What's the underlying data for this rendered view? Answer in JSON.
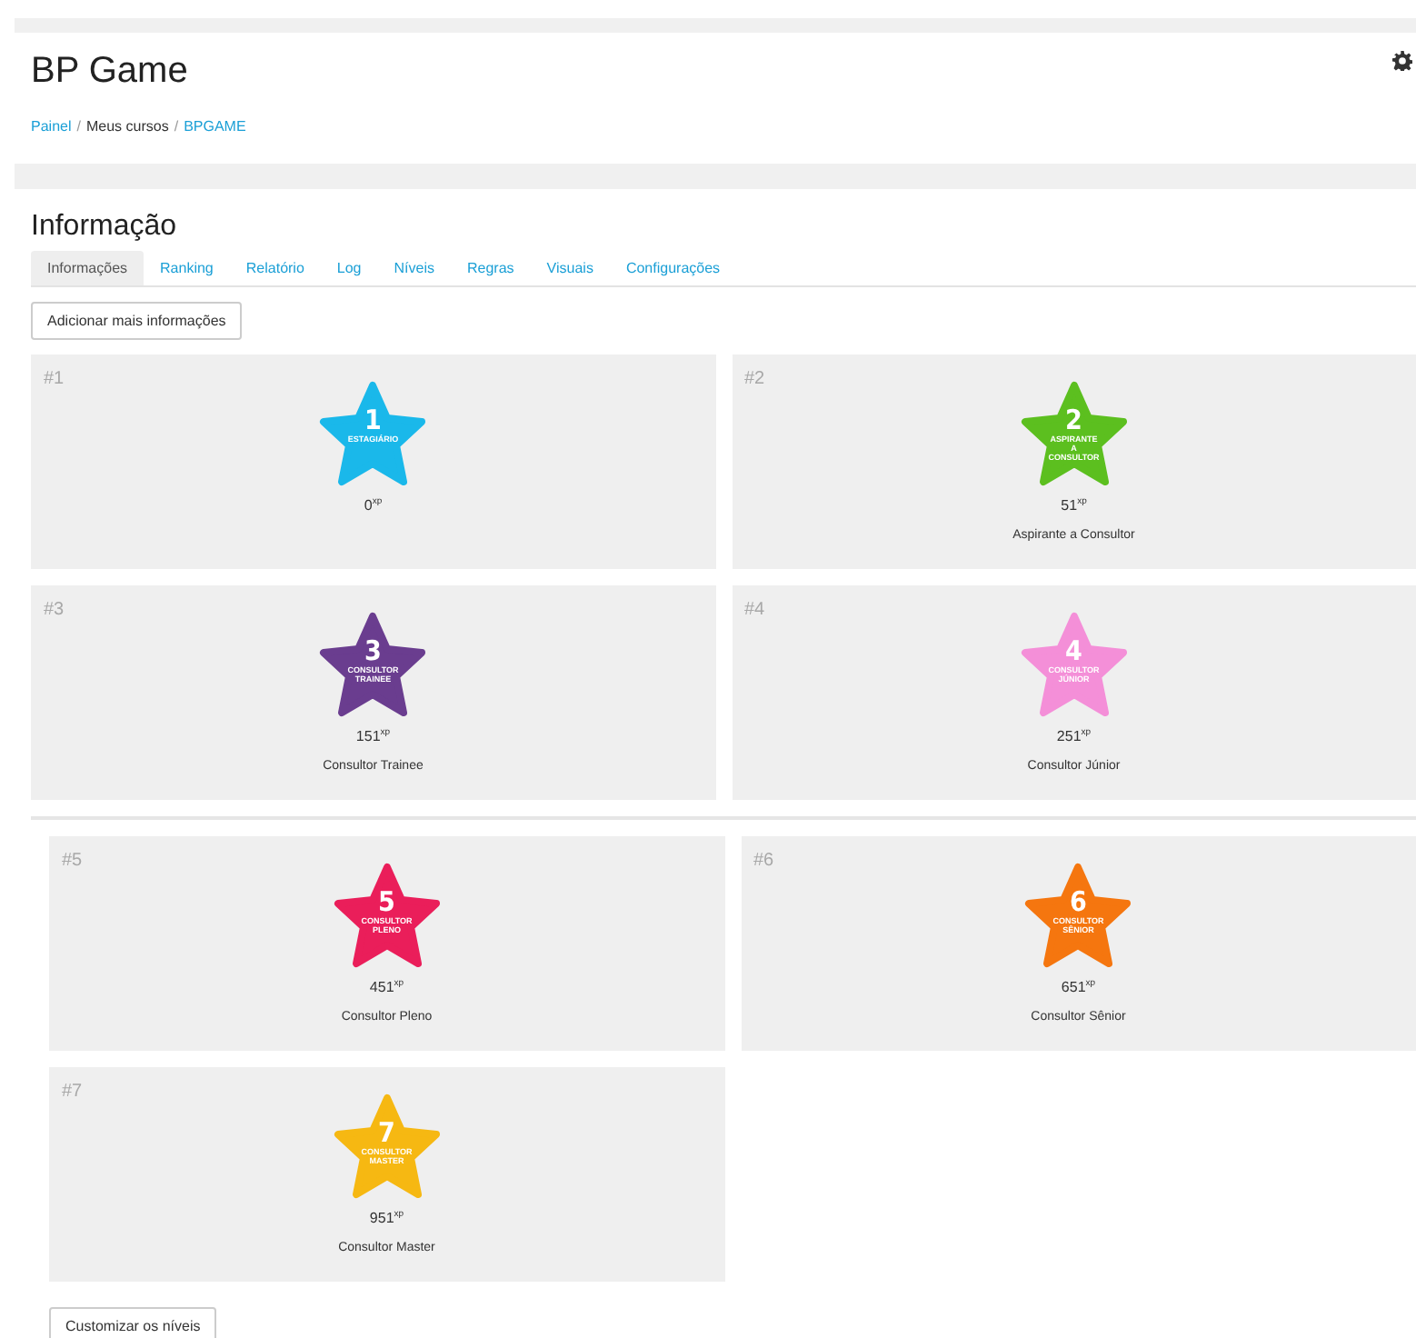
{
  "header": {
    "title": "BP Game",
    "breadcrumb": [
      {
        "label": "Painel",
        "kind": "link"
      },
      {
        "label": "/",
        "kind": "separator"
      },
      {
        "label": "Meus cursos",
        "kind": "text"
      },
      {
        "label": "/",
        "kind": "separator"
      },
      {
        "label": "BPGAME",
        "kind": "link"
      }
    ]
  },
  "section_title": "Informação",
  "tabs": [
    {
      "label": "Informações",
      "selected": true
    },
    {
      "label": "Ranking",
      "selected": false
    },
    {
      "label": "Relatório",
      "selected": false
    },
    {
      "label": "Log",
      "selected": false
    },
    {
      "label": "Níveis",
      "selected": false
    },
    {
      "label": "Regras",
      "selected": false
    },
    {
      "label": "Visuais",
      "selected": false
    },
    {
      "label": "Configurações",
      "selected": false
    }
  ],
  "add_button": "Adicionar mais informações",
  "groups": [
    {
      "levels": [
        {
          "index": "#1",
          "number": "1",
          "badge_lines": [
            "ESTAGIÁRIO"
          ],
          "points": "0$^{xp}$",
          "color": "#1ab8ea"
        },
        {
          "index": "#2",
          "number": "2",
          "badge_lines": [
            "ASPIRANTE",
            "A",
            "CONSULTOR"
          ],
          "points": "51$^{xp}$",
          "name": "Aspirante a Consultor",
          "color": "#5cbf1f"
        },
        {
          "index": "#3",
          "number": "3",
          "badge_lines": [
            "CONSULTOR",
            "TRAINEE"
          ],
          "points": "151$^{xp}$",
          "name": "Consultor Trainee",
          "color": "#6a3d8f"
        },
        {
          "index": "#4",
          "number": "4",
          "badge_lines": [
            "CONSULTOR",
            "JÚNIOR"
          ],
          "points": "251$^{xp}$",
          "name": "Consultor Júnior",
          "color": "#f48fd8"
        }
      ]
    },
    {
      "levels": [
        {
          "index": "#5",
          "number": "5",
          "badge_lines": [
            "CONSULTOR",
            "PLENO"
          ],
          "points": "451$^{xp}$",
          "name": "Consultor Pleno",
          "color": "#ea1e5a"
        },
        {
          "index": "#6",
          "number": "6",
          "badge_lines": [
            "CONSULTOR",
            "SÊNIOR"
          ],
          "points": "651$^{xp}$",
          "name": "Consultor Sênior",
          "color": "#f5760f"
        },
        {
          "index": "#7",
          "number": "7",
          "badge_lines": [
            "CONSULTOR",
            "MASTER"
          ],
          "points": "951$^{xp}$",
          "name": "Consultor Master",
          "color": "#f6b812"
        }
      ]
    }
  ],
  "customize_button": "Customizar os níveis"
}
